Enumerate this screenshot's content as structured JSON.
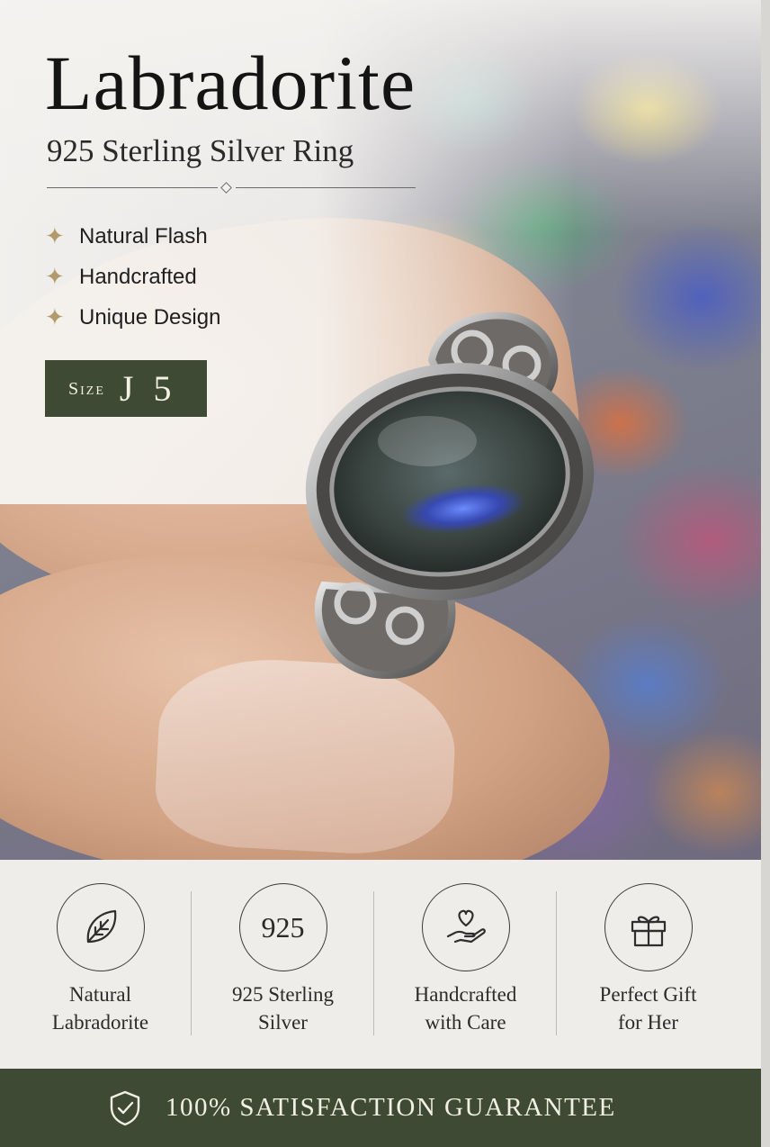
{
  "product": {
    "title": "Labradorite",
    "subtitle": "925 Sterling Silver Ring"
  },
  "features": [
    {
      "icon": "sparkle-icon",
      "label": "Natural Flash"
    },
    {
      "icon": "sparkle-icon",
      "label": "Handcrafted"
    },
    {
      "icon": "sparkle-icon",
      "label": "Unique Design"
    }
  ],
  "size": {
    "word": "Size",
    "value": "J 5"
  },
  "benefits": [
    {
      "icon": "leaf-icon",
      "line1": "Natural",
      "line2": "Labradorite"
    },
    {
      "icon": "badge-925",
      "badge_text": "925",
      "line1": "925 Sterling",
      "line2": "Silver"
    },
    {
      "icon": "heart-hand-icon",
      "line1": "Handcrafted",
      "line2": "with Care"
    },
    {
      "icon": "gift-icon",
      "line1": "Perfect Gift",
      "line2": "for Her"
    }
  ],
  "guarantee": {
    "icon": "shield-check-icon",
    "text": "100% SATISFACTION GUARANTEE"
  },
  "colors": {
    "accent_green": "#3e4a33",
    "accent_gold": "#b39a6a",
    "strip_background": "#eeedea"
  }
}
